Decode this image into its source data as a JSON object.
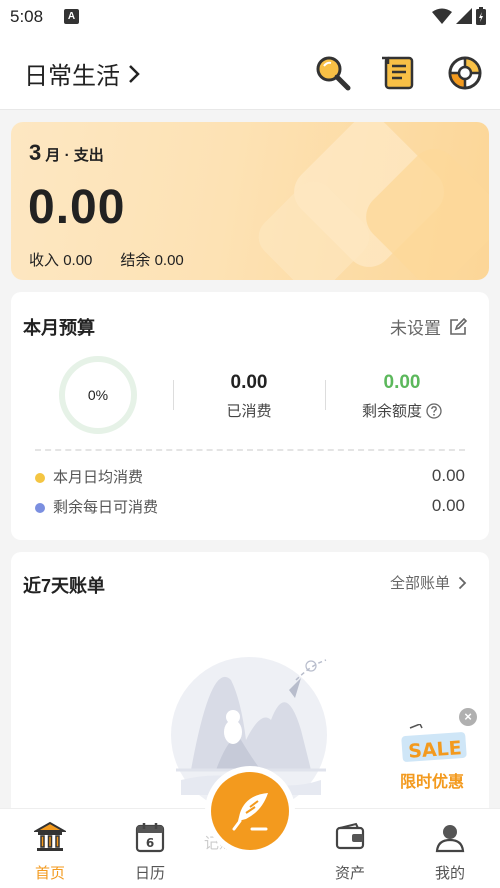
{
  "status_bar": {
    "time": "5:08",
    "app_badge": "A"
  },
  "header": {
    "book_title": "日常生活",
    "icons": [
      "search-icon",
      "bill-scroll-icon",
      "pie-chart-icon"
    ]
  },
  "summary": {
    "month_number": "3",
    "month_label": "月 · 支出",
    "expense_amount": "0.00",
    "income_label": "收入",
    "income_value": "0.00",
    "balance_label": "结余",
    "balance_value": "0.00"
  },
  "budget": {
    "title": "本月预算",
    "action_label": "未设置",
    "progress_label": "0%",
    "progress": 0,
    "spent_value": "0.00",
    "spent_label": "已消费",
    "remaining_value": "0.00",
    "remaining_label": "剩余额度",
    "rows": [
      {
        "label": "本月日均消费",
        "value": "0.00",
        "dot_color": "#f4c542"
      },
      {
        "label": "剩余每日可消费",
        "value": "0.00",
        "dot_color": "#7b8fe0"
      }
    ]
  },
  "bills": {
    "title": "近7天账单",
    "all_label": "全部账单",
    "empty_hint_partial": "记账"
  },
  "promo": {
    "text": "限时优惠",
    "badge_text": "SALE",
    "close": "×"
  },
  "tabs": [
    {
      "label": "首页",
      "icon": "bank-icon",
      "active": true
    },
    {
      "label": "日历",
      "icon": "calendar-icon",
      "day": "6",
      "active": false
    },
    {
      "label": "资产",
      "icon": "wallet-icon",
      "active": false
    },
    {
      "label": "我的",
      "icon": "user-icon",
      "active": false
    }
  ],
  "colors": {
    "accent": "#f39a1e",
    "green": "#5cb85c",
    "card_bg": "#fde2b4"
  }
}
